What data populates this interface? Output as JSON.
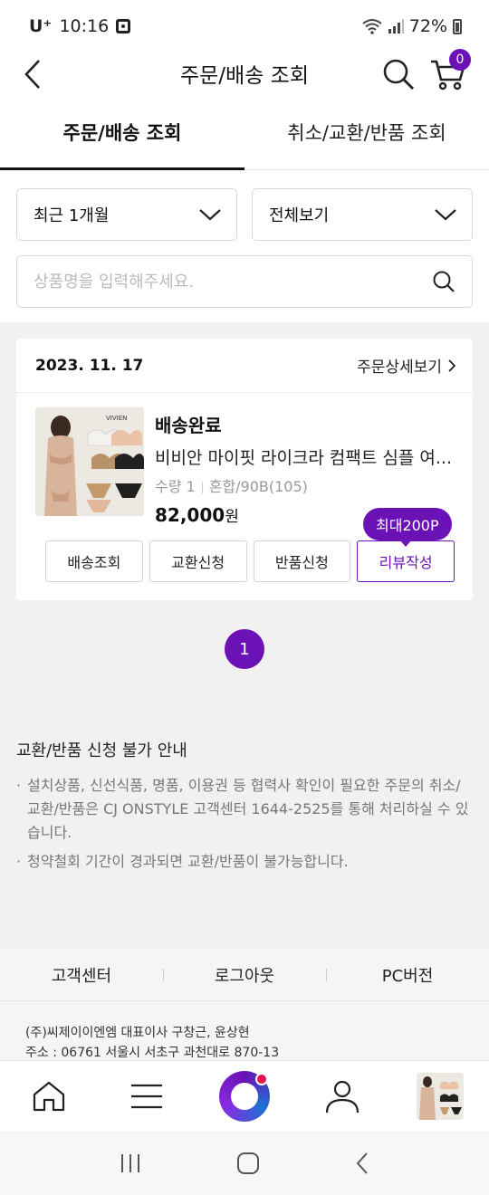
{
  "status_bar": {
    "carrier": "U⁺",
    "time": "10:16",
    "battery": "72%"
  },
  "header": {
    "title": "주문/배송 조회",
    "cart_count": "0"
  },
  "tabs": [
    {
      "label": "주문/배송 조회",
      "active": true
    },
    {
      "label": "취소/교환/반품 조회",
      "active": false
    }
  ],
  "filters": {
    "period": "최근 1개월",
    "type": "전체보기"
  },
  "search": {
    "placeholder": "상품명을 입력해주세요."
  },
  "order": {
    "date": "2023. 11. 17",
    "detail_link": "주문상세보기",
    "status": "배송완료",
    "product_name": "비비안 마이핏 라이크라 컴팩트 심플 여...",
    "quantity": "수량 1",
    "option": "혼합/90B(105)",
    "price": "82,000",
    "currency": "원",
    "thumb_brand": "VIVIEN",
    "buttons": [
      "배송조회",
      "교환신청",
      "반품신청",
      "리뷰작성"
    ],
    "review_tooltip": "최대200P"
  },
  "pagination": {
    "current": "1"
  },
  "notice": {
    "title": "교환/반품 신청 불가 안내",
    "items": [
      "설치상품, 신선식품, 명품, 이용권 등 협력사 확인이 필요한 주문의 취소/교환/반품은 CJ ONSTYLE 고객센터 1644-2525를 통해 처리하실 수 있습니다.",
      "청약철회 기간이 경과되면 교환/반품이 불가능합니다."
    ]
  },
  "footer": {
    "links": [
      "고객센터",
      "로그아웃",
      "PC버전"
    ],
    "company_line1": "(주)씨제이이엔엠 대표이사 구창근, 윤상현",
    "company_line2": "주소 : 06761 서울시 서초구 과천대로 870-13"
  },
  "colors": {
    "accent": "#6a12b6",
    "background_gray": "#f1f1f1"
  }
}
